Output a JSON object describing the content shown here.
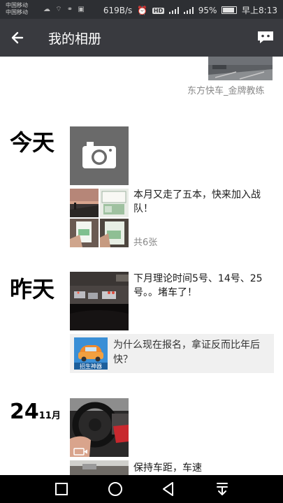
{
  "status_bar": {
    "carrier_1": "中国移动",
    "carrier_2": "中国移动",
    "net_speed": "619B/s",
    "hd": "HD",
    "battery": "95%",
    "time": "早上8:13"
  },
  "app_bar": {
    "title": "我的相册",
    "back_icon": "arrow-left-icon",
    "more_icon": "message-bubble-icon"
  },
  "timeline": {
    "top_entry": {
      "author": "东方快车_金牌教练"
    },
    "today": {
      "label": "今天",
      "camera_icon": "camera-icon",
      "post": {
        "text": "本月又走了五本，快来加入战队！",
        "count": "共6张"
      }
    },
    "yesterday": {
      "label": "昨天",
      "post": {
        "text": "下月理论时间5号、14号、25号。。堵车了！"
      },
      "share": {
        "text": "为什么现在报名，拿证反而比年后快？",
        "logo_text": "招生神器"
      }
    },
    "nov24": {
      "day": "24",
      "month": "11月",
      "video_icon": "video-icon",
      "post": {
        "text": "保持车距，车速"
      }
    }
  },
  "nav_bar": {
    "buttons": [
      "square-icon",
      "circle-icon",
      "triangle-back-icon",
      "download-icon"
    ]
  },
  "colors": {
    "status_bar": "#2d2f33",
    "app_bar": "#393a3f",
    "nav_bar": "#000000",
    "camera_tile": "#6a6a6a",
    "share_card": "#f0f0f0"
  }
}
